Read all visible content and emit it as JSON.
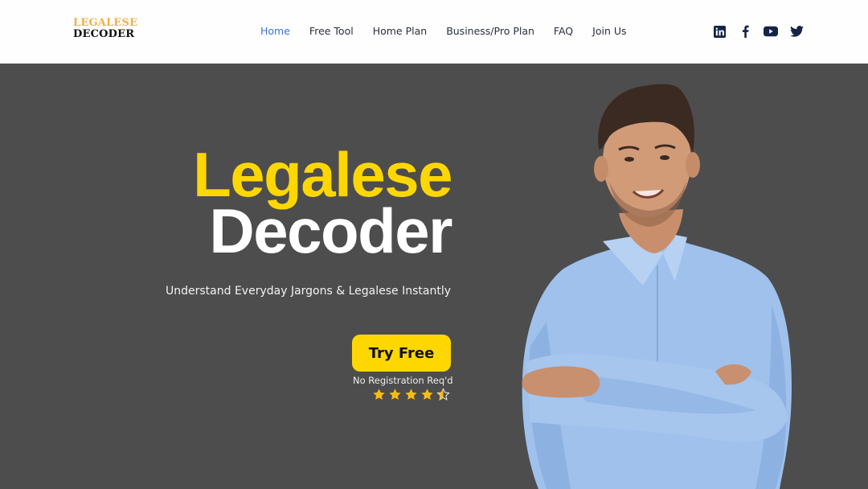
{
  "header": {
    "logo": {
      "line1": "LEGALESE",
      "line2": "DECODER"
    },
    "nav": [
      {
        "label": "Home",
        "active": true
      },
      {
        "label": "Free Tool",
        "active": false
      },
      {
        "label": "Home Plan",
        "active": false
      },
      {
        "label": "Business/Pro Plan",
        "active": false
      },
      {
        "label": "FAQ",
        "active": false
      },
      {
        "label": "Join Us",
        "active": false
      }
    ],
    "social": [
      "linkedin-icon",
      "facebook-icon",
      "youtube-icon",
      "twitter-icon"
    ]
  },
  "hero": {
    "title_line1": "Legalese",
    "title_line2": "Decoder",
    "subtitle": "Understand Everyday Jargons & Legalese Instantly",
    "cta_label": "Try Free",
    "cta_note": "No Registration Req'd",
    "rating": 4.5,
    "rating_max": 5,
    "image": "smiling-man-blue-shirt-arms-crossed"
  },
  "colors": {
    "accent_yellow": "#fed700",
    "nav_active": "#3b72d6",
    "hero_bg": "#4d4d4d",
    "logo_gold": "#f0b04a"
  }
}
